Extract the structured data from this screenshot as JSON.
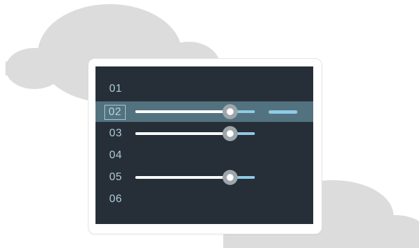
{
  "rows": [
    {
      "label": "01"
    },
    {
      "label": "02",
      "selected": true,
      "slider_level": 0.78
    },
    {
      "label": "03",
      "slider_level": 0.78
    },
    {
      "label": "04"
    },
    {
      "label": "05",
      "slider_level": 0.78
    },
    {
      "label": "06"
    }
  ],
  "colors": {
    "screen_background": "#262f38",
    "selected_row": "#53727f",
    "row_text": "#aecbd8",
    "slider_fill": "#ffffff",
    "slider_remainder": "#8fcbe6",
    "slider_thumb": "#9da6ab",
    "cloud": "#dcdcdc"
  },
  "icons": {
    "background": "cloud-illustration"
  }
}
